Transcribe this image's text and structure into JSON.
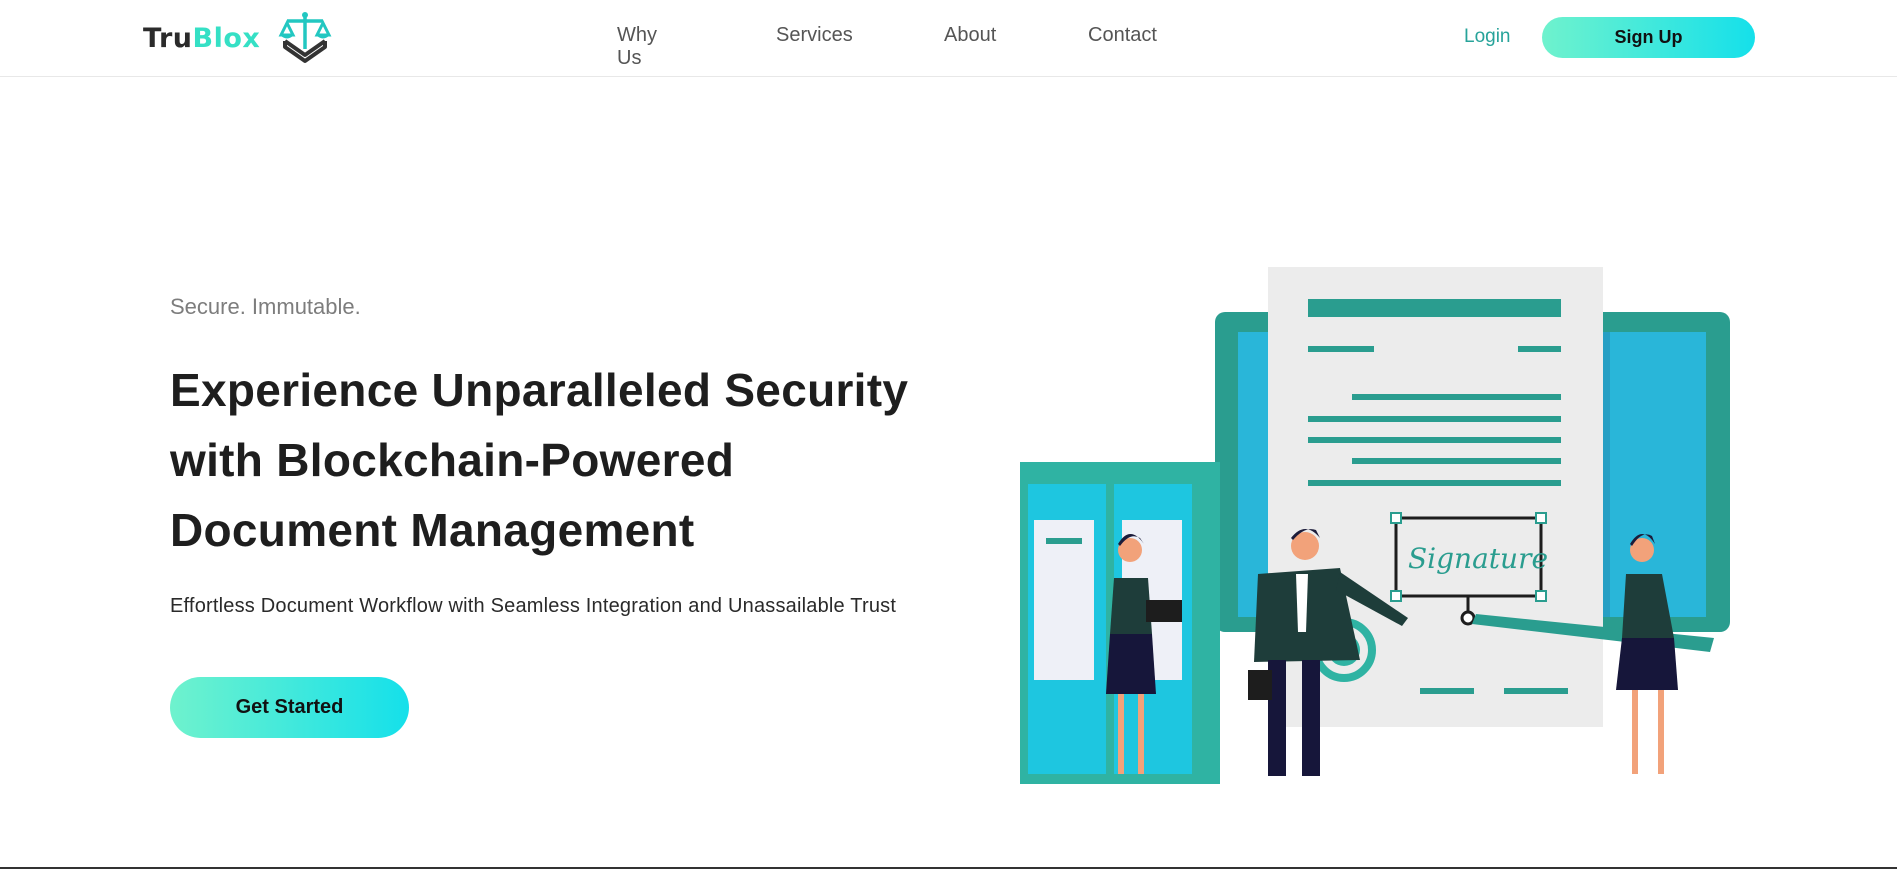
{
  "brand": {
    "tru": "Tru",
    "blox": "Blox"
  },
  "nav": {
    "items": [
      {
        "label": "Why Us"
      },
      {
        "label": "Services"
      },
      {
        "label": "About"
      },
      {
        "label": "Contact"
      }
    ]
  },
  "auth": {
    "login_label": "Login",
    "signup_label": "Sign Up"
  },
  "hero": {
    "eyebrow": "Secure. Immutable.",
    "headline_line1": "Experience Unparalleled Security",
    "headline_line2": "with Blockchain-Powered",
    "headline_line3": "Document Management",
    "subline": "Effortless Document Workflow with Seamless Integration and Unassailable Trust",
    "cta_label": "Get Started"
  },
  "illustration": {
    "signature_text": "Signature"
  },
  "colors": {
    "accent_gradient_start": "#6ff2cd",
    "accent_gradient_end": "#15e0ea",
    "teal": "#2a9d8f",
    "link": "#27a39a"
  },
  "icons": {
    "logo": "scales-cube-icon"
  }
}
